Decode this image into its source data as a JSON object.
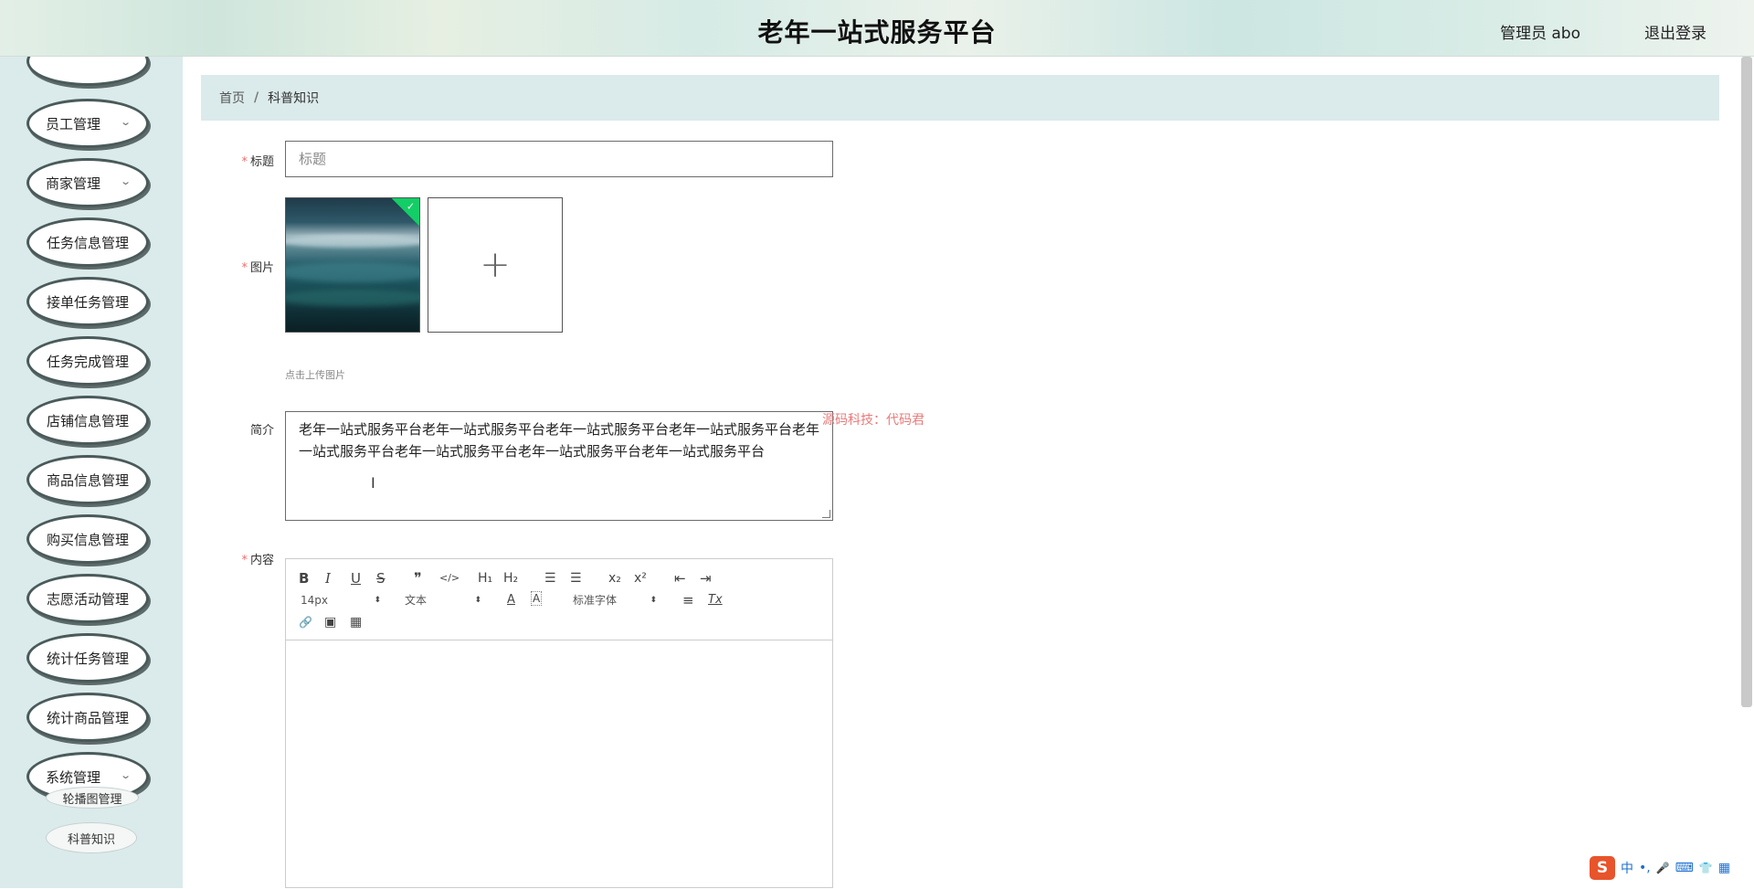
{
  "header": {
    "title": "老年一站式服务平台",
    "user": "管理员 abo",
    "logout": "退出登录"
  },
  "sidebar": {
    "items": [
      {
        "label": "员工管理",
        "has_sub": true
      },
      {
        "label": "商家管理",
        "has_sub": true
      },
      {
        "label": "任务信息管理"
      },
      {
        "label": "接单任务管理"
      },
      {
        "label": "任务完成管理"
      },
      {
        "label": "店铺信息管理"
      },
      {
        "label": "商品信息管理"
      },
      {
        "label": "购买信息管理"
      },
      {
        "label": "志愿活动管理"
      },
      {
        "label": "统计任务管理"
      },
      {
        "label": "统计商品管理"
      },
      {
        "label": "系统管理",
        "has_sub": true
      }
    ],
    "sub_items": [
      "轮播图管理",
      "科普知识"
    ]
  },
  "breadcrumb": {
    "home": "首页",
    "separator": "/",
    "current": "科普知识"
  },
  "form": {
    "title_label": "标题",
    "title_placeholder": "标题",
    "image_label": "图片",
    "upload_plus": "+",
    "upload_tip": "点击上传图片",
    "intro_label": "简介",
    "intro_value": "老年一站式服务平台老年一站式服务平台老年一站式服务平台老年一站式服务平台老年一站式服务平台老年一站式服务平台老年一站式服务平台老年一站式服务平台",
    "content_label": "内容",
    "required_mark": "*"
  },
  "watermark": "源码科技：代码君",
  "editor": {
    "toolbar": {
      "bold": "B",
      "italic": "I",
      "underline": "U",
      "strike": "S",
      "blockquote": "❞",
      "code": "</>",
      "h1": "H₁",
      "h2": "H₂",
      "ordered_list": "☰",
      "bullet_list": "☰",
      "subscript": "x₂",
      "superscript": "x²",
      "outdent": "⇤",
      "indent": "⇥",
      "size_value": "14px",
      "header_value": "文本",
      "color": "A",
      "background": "A",
      "font_value": "标准字体",
      "align": "≡",
      "clean": "Tx",
      "link": "🔗",
      "image": "▣",
      "video": "▦"
    }
  },
  "ime": {
    "logo": "S",
    "lang": "中",
    "punct": "•,",
    "mic": "🎤",
    "keyboard": "⌨",
    "skin": "👕",
    "grid": "▦"
  },
  "colors": {
    "accent": "#dbeaea",
    "required": "#f56c6c",
    "success": "#13ce66",
    "watermark": "#e87b7b"
  }
}
